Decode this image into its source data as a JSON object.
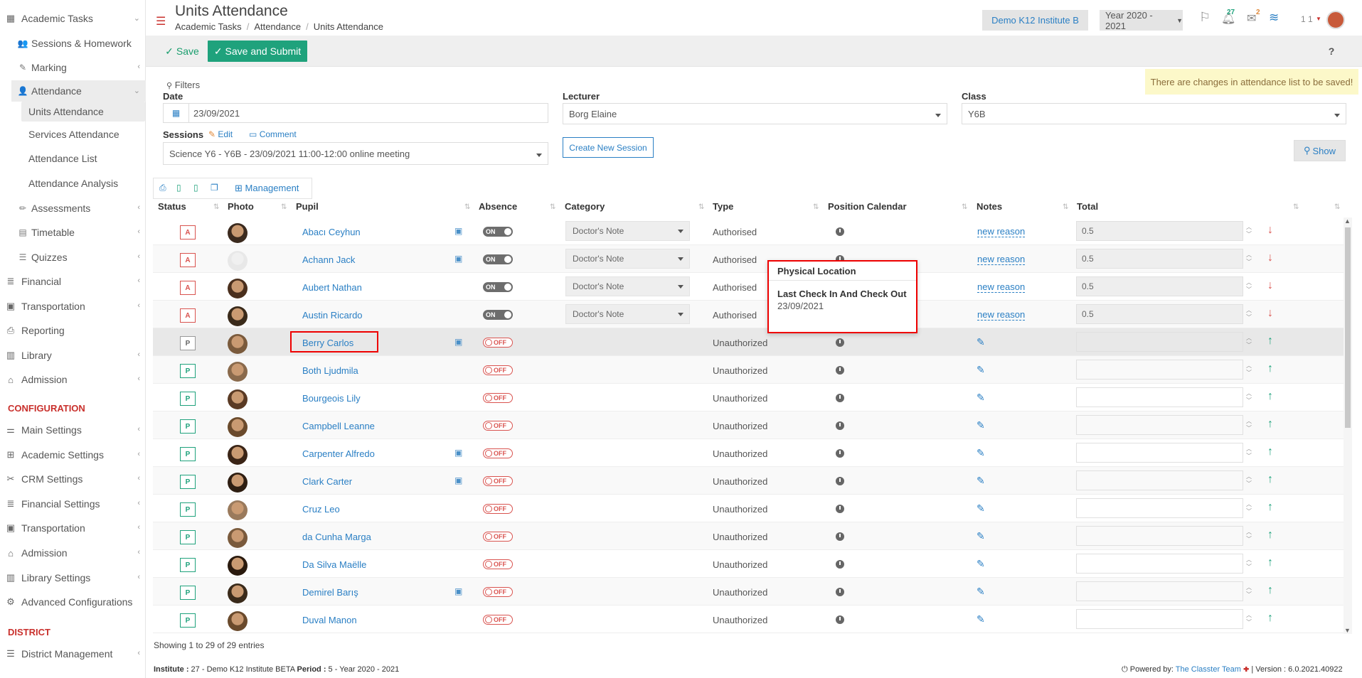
{
  "sidebar": {
    "academic_tasks": "Academic Tasks",
    "sessions_homework": "Sessions & Homework",
    "marking": "Marking",
    "attendance": "Attendance",
    "units_attendance": "Units Attendance",
    "services_attendance": "Services Attendance",
    "attendance_list": "Attendance List",
    "attendance_analysis": "Attendance Analysis",
    "assessments": "Assessments",
    "timetable": "Timetable",
    "quizzes": "Quizzes",
    "financial": "Financial",
    "transportation": "Transportation",
    "reporting": "Reporting",
    "library": "Library",
    "admission": "Admission",
    "configuration_heading": "CONFIGURATION",
    "main_settings": "Main Settings",
    "academic_settings": "Academic Settings",
    "crm_settings": "CRM Settings",
    "financial_settings": "Financial Settings",
    "transportation2": "Transportation",
    "admission2": "Admission",
    "library_settings": "Library Settings",
    "advanced_configurations": "Advanced Configurations",
    "district_heading": "DISTRICT",
    "district_management": "District Management"
  },
  "header": {
    "title": "Units Attendance",
    "breadcrumb": [
      "Academic Tasks",
      "Attendance",
      "Units Attendance"
    ],
    "institute": "Demo K12 Institute B",
    "year": "Year 2020 - 2021",
    "notifications_count": "27",
    "messages_count": "2",
    "user_counter": "1 1"
  },
  "toolbar": {
    "save_label": "Save",
    "save_submit_label": "Save and Submit",
    "help": "?"
  },
  "notice": "There are changes in attendance list to be saved!",
  "filters": {
    "title": "Filters",
    "date_label": "Date",
    "date_value": "23/09/2021",
    "lecturer_label": "Lecturer",
    "lecturer_value": "Borg Elaine",
    "class_label": "Class",
    "class_value": "Y6B",
    "sessions_label": "Sessions",
    "edit_label": "Edit",
    "comment_label": "Comment",
    "session_value": "Science Y6 - Y6B - 23/09/2021 11:00-12:00 online meeting",
    "create_session": "Create New Session",
    "show": "Show"
  },
  "management_label": "Management",
  "columns": [
    "Status",
    "Photo",
    "Pupil",
    "Absence",
    "Category",
    "Type",
    "Position Calendar",
    "Notes",
    "Total"
  ],
  "rows": [
    {
      "status": "A",
      "name": "Abacı Ceyhun",
      "bus": true,
      "absence": "ON",
      "category": "Doctor's Note",
      "type": "Authorised",
      "note": "new reason",
      "total": "0.5",
      "dir": "down"
    },
    {
      "status": "A",
      "name": "Achann Jack",
      "bus": true,
      "absence": "ON",
      "category": "Doctor's Note",
      "type": "Authorised",
      "note": "new reason",
      "total": "0.5",
      "dir": "down"
    },
    {
      "status": "A",
      "name": "Aubert Nathan",
      "bus": false,
      "absence": "ON",
      "category": "Doctor's Note",
      "type": "Authorised",
      "note": "new reason",
      "total": "0.5",
      "dir": "down"
    },
    {
      "status": "A",
      "name": "Austin Ricardo",
      "bus": false,
      "absence": "ON",
      "category": "Doctor's Note",
      "type": "Authorised",
      "note": "new reason",
      "total": "0.5",
      "dir": "down"
    },
    {
      "status": "P",
      "name": "Berry Carlos",
      "bus": true,
      "absence": "OFF",
      "category": "",
      "type": "Unauthorized",
      "note": "",
      "total": "",
      "dir": "up"
    },
    {
      "status": "P",
      "name": "Both Ljudmila",
      "bus": false,
      "absence": "OFF",
      "category": "",
      "type": "Unauthorized",
      "note": "",
      "total": "",
      "dir": "up"
    },
    {
      "status": "P",
      "name": "Bourgeois Lily",
      "bus": false,
      "absence": "OFF",
      "category": "",
      "type": "Unauthorized",
      "note": "",
      "total": "",
      "dir": "up"
    },
    {
      "status": "P",
      "name": "Campbell Leanne",
      "bus": false,
      "absence": "OFF",
      "category": "",
      "type": "Unauthorized",
      "note": "",
      "total": "",
      "dir": "up"
    },
    {
      "status": "P",
      "name": "Carpenter Alfredo",
      "bus": true,
      "absence": "OFF",
      "category": "",
      "type": "Unauthorized",
      "note": "",
      "total": "",
      "dir": "up"
    },
    {
      "status": "P",
      "name": "Clark Carter",
      "bus": true,
      "absence": "OFF",
      "category": "",
      "type": "Unauthorized",
      "note": "",
      "total": "",
      "dir": "up"
    },
    {
      "status": "P",
      "name": "Cruz Leo",
      "bus": false,
      "absence": "OFF",
      "category": "",
      "type": "Unauthorized",
      "note": "",
      "total": "",
      "dir": "up"
    },
    {
      "status": "P",
      "name": "da Cunha Marga",
      "bus": false,
      "absence": "OFF",
      "category": "",
      "type": "Unauthorized",
      "note": "",
      "total": "",
      "dir": "up"
    },
    {
      "status": "P",
      "name": "Da Silva Maëlle",
      "bus": false,
      "absence": "OFF",
      "category": "",
      "type": "Unauthorized",
      "note": "",
      "total": "",
      "dir": "up"
    },
    {
      "status": "P",
      "name": "Demirel Barış",
      "bus": true,
      "absence": "OFF",
      "category": "",
      "type": "Unauthorized",
      "note": "",
      "total": "",
      "dir": "up"
    },
    {
      "status": "P",
      "name": "Duval Manon",
      "bus": false,
      "absence": "OFF",
      "category": "",
      "type": "Unauthorized",
      "note": "",
      "total": "",
      "dir": "up"
    }
  ],
  "popover": {
    "title": "Physical Location",
    "subtitle": "Last Check In And Check Out",
    "date": "23/09/2021"
  },
  "footer": {
    "entries": "Showing 1 to 29 of 29 entries",
    "institute_label": "Institute :",
    "institute_value": " 27 - Demo K12 Institute BETA ",
    "period_label": "Period :",
    "period_value": " 5 - Year 2020 - 2021",
    "powered_by": "Powered by: ",
    "team": "The Classter Team",
    "version": " | Version : 6.0.2021.40922"
  }
}
